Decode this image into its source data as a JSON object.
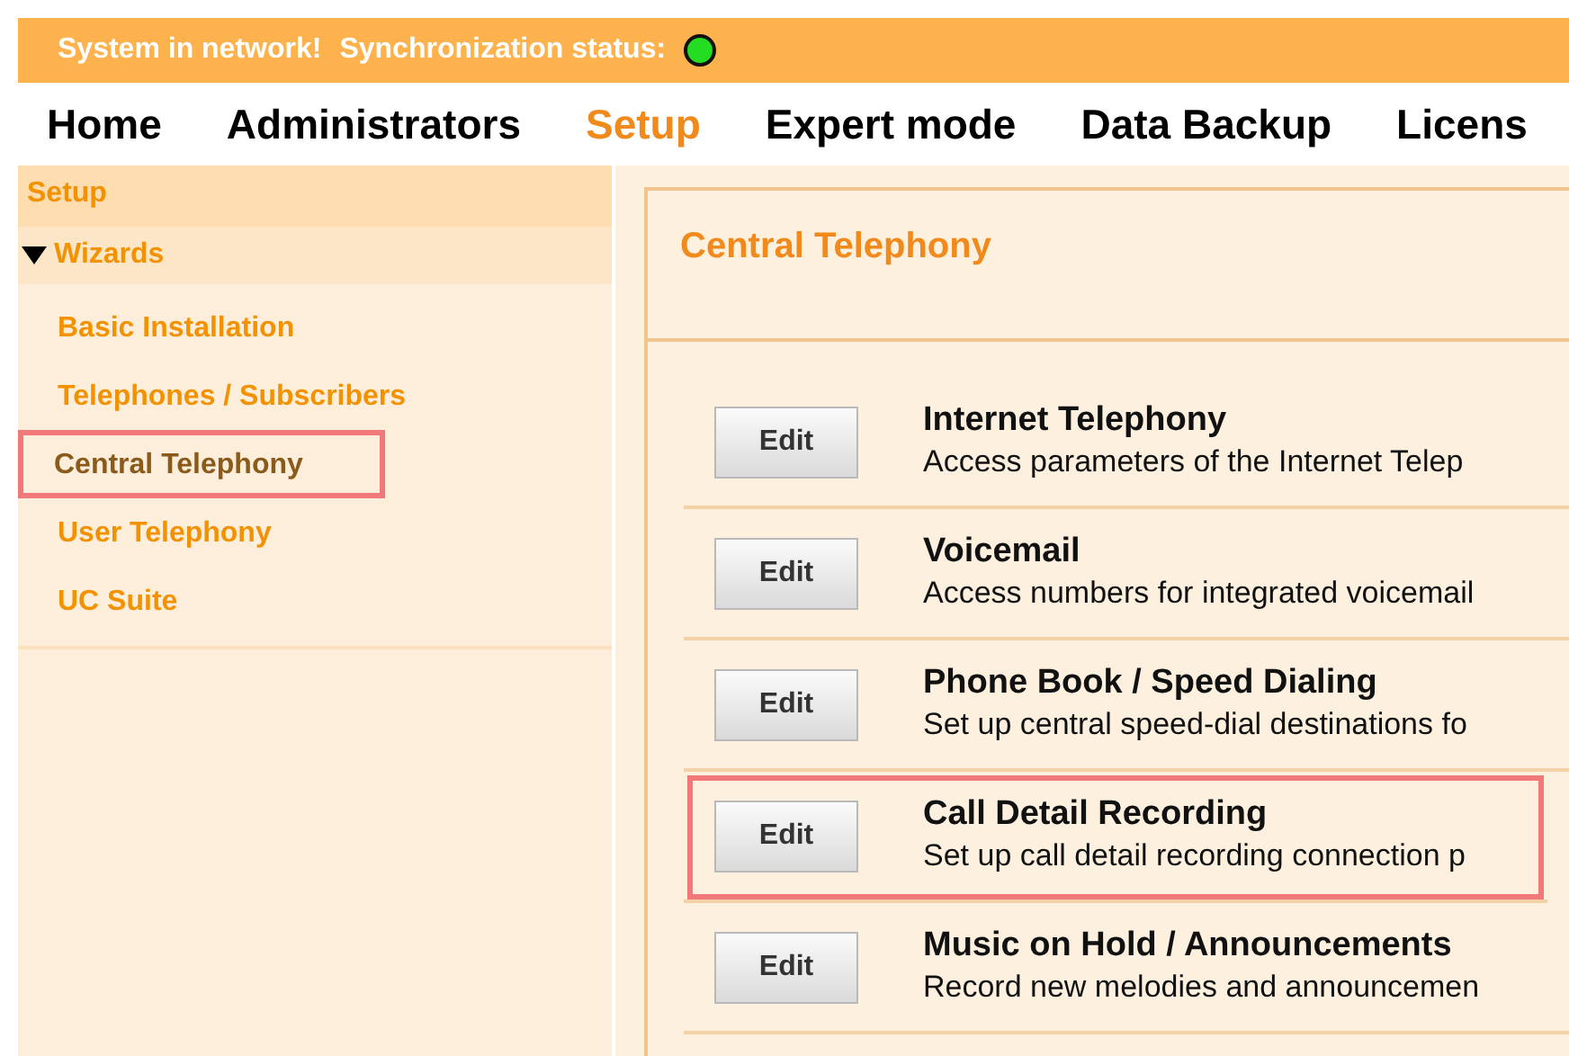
{
  "status_bar": {
    "message": "System in network!",
    "sync_label": "Synchronization status:",
    "synchronized": true
  },
  "nav": [
    {
      "label": "Home",
      "selected": false
    },
    {
      "label": "Administrators",
      "selected": false
    },
    {
      "label": "Setup",
      "selected": true
    },
    {
      "label": "Expert mode",
      "selected": false
    },
    {
      "label": "Data Backup",
      "selected": false
    },
    {
      "label": "Licens",
      "selected": false
    }
  ],
  "sidebar": {
    "title": "Setup",
    "group": {
      "label": "Wizards",
      "expanded": true,
      "items": [
        {
          "label": "Basic Installation",
          "selected": false,
          "highlighted": false
        },
        {
          "label": "Telephones / Subscribers",
          "selected": false,
          "highlighted": false
        },
        {
          "label": "Central Telephony",
          "selected": true,
          "highlighted": true
        },
        {
          "label": "User Telephony",
          "selected": false,
          "highlighted": false
        },
        {
          "label": "UC Suite",
          "selected": false,
          "highlighted": false
        }
      ]
    }
  },
  "panel": {
    "title": "Central Telephony",
    "rows": [
      {
        "button": "Edit",
        "title": "Internet Telephony",
        "description": "Access parameters of the Internet Telep",
        "highlighted": false
      },
      {
        "button": "Edit",
        "title": "Voicemail",
        "description": "Access numbers for integrated voicemail",
        "highlighted": false
      },
      {
        "button": "Edit",
        "title": "Phone Book / Speed Dialing",
        "description": "Set up central speed-dial destinations fo",
        "highlighted": false
      },
      {
        "button": "Edit",
        "title": "Call Detail Recording",
        "description": "Set up call detail recording connection p",
        "highlighted": true
      },
      {
        "button": "Edit",
        "title": "Music on Hold / Announcements",
        "description": "Record new melodies and announcemen",
        "highlighted": false
      }
    ]
  }
}
